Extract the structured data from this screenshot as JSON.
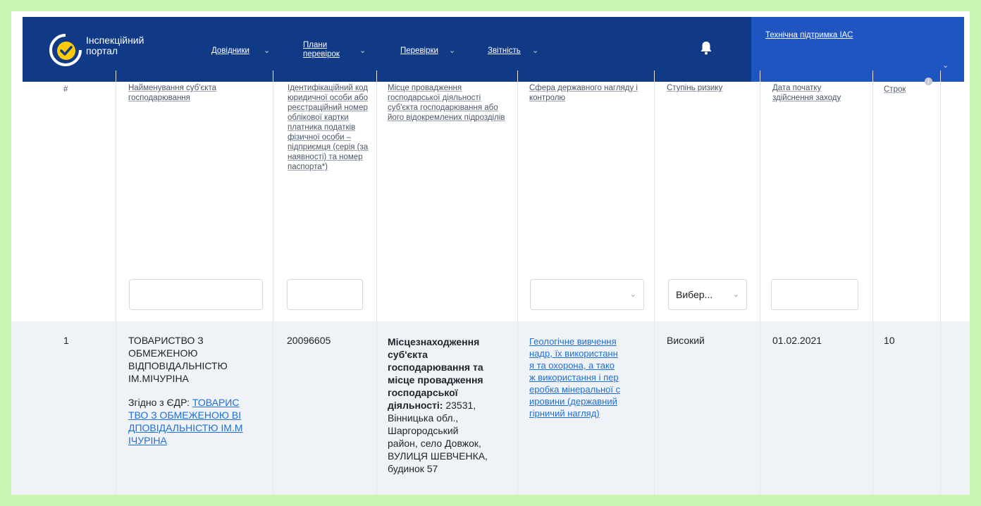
{
  "app": {
    "brand_line1": "Інспекційний",
    "brand_line2": "портал",
    "accent": "#103a86",
    "support_bg": "#1e55c0"
  },
  "nav": {
    "dovidnyky": "Довідники",
    "plany_line1": "Плани",
    "plany_line2": "перевірок",
    "perevirky": "Перевірки",
    "zvitnist": "Звітність",
    "support": "Технічна підтримка ІАС"
  },
  "table": {
    "headers": {
      "num": "#",
      "name": "Найменування суб'єкта господарювання",
      "code": "Ідентифікаційний код юридичної особи або реєстраційний номер облікової картки платника податків фізичної особи – підприємця (серія (за наявності) та номер паспорта*)",
      "place": "Місце провадження господарської діяльності суб'єкта господарювання або його відокремлених підрозділів",
      "sphere": "Сфера державного нагляду і контролю",
      "risk": "Ступінь ризику",
      "date": "Дата початку здійснення заходу",
      "term": "Строк"
    },
    "filters": {
      "name_value": "",
      "code_value": "",
      "sphere_value": "",
      "risk_value": "Вибер...",
      "date_value": ""
    },
    "rows": [
      {
        "num": "1",
        "name_lines": [
          "ТОВАРИСТВО З",
          "ОБМЕЖЕНОЮ",
          "ВІДПОВІДАЛЬНІСТЮ",
          "ІМ.МІЧУРІНА"
        ],
        "edr_prefix": "Згідно з ЄДР: ",
        "edr_link_lines": [
          "ТОВАРИС",
          "ТВО З ОБМЕЖЕНОЮ ВІ",
          "ДПОВІДАЛЬНІСТЮ ІМ.М",
          "ІЧУРІНА"
        ],
        "code": "20096605",
        "place_bold_lines": [
          "Місцезнаходження",
          "суб'єкта",
          "господарювання та",
          "місце провадження",
          "господарської",
          "діяльності:"
        ],
        "place_text_lines": [
          " 23531,",
          "Вінницька обл.,",
          "Шаргородський",
          "район, село Довжок,",
          "ВУЛИЦЯ ШЕВЧЕНКА,",
          "будинок 57"
        ],
        "sphere_lines": [
          "Геологічне вивчення",
          "надр, їх використанн",
          "я та охорона, а тако",
          "ж використання і пер",
          "еробка мінеральної с",
          "ировини (державний",
          "гірничий нагляд)"
        ],
        "risk": "Високий",
        "date": "01.02.2021",
        "term": "10"
      }
    ]
  }
}
